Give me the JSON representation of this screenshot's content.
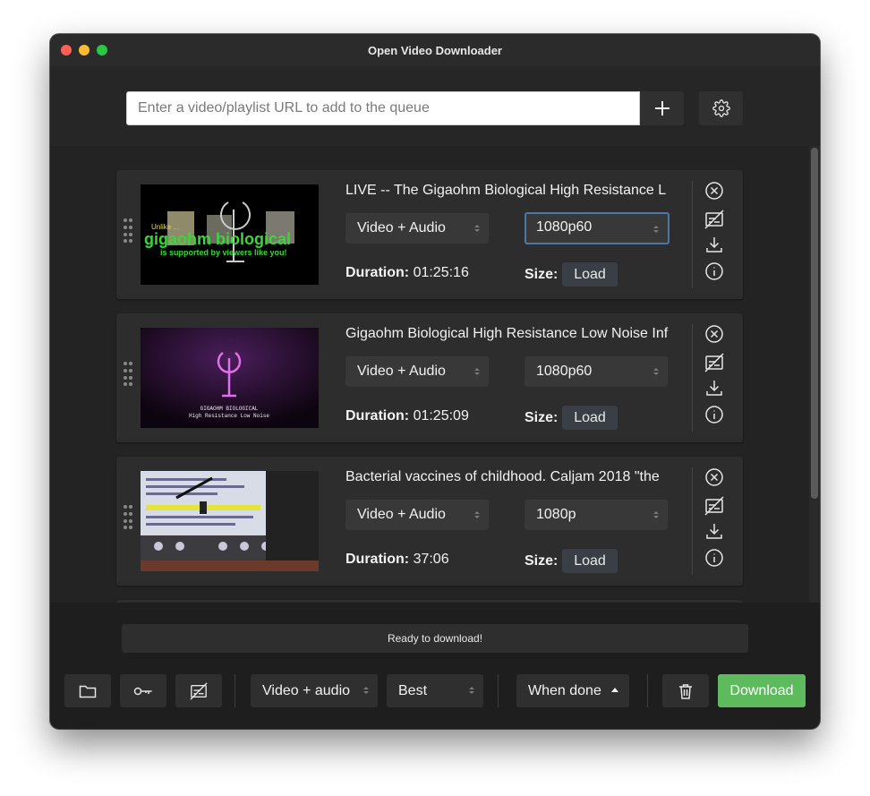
{
  "window": {
    "title": "Open Video Downloader"
  },
  "url_bar": {
    "placeholder": "Enter a video/playlist URL to add to the queue"
  },
  "queue": [
    {
      "title": "LIVE -- The Gigaohm Biological High Resistance L",
      "type": "Video + Audio",
      "quality": "1080p60",
      "duration_label": "Duration:",
      "duration": "01:25:16",
      "size_label": "Size:",
      "load_label": "Load",
      "thumbnail": {
        "line1": "Unlike ...",
        "line2": "gigaohm biological",
        "line3": "is supported by viewers like you!"
      }
    },
    {
      "title": "Gigaohm Biological High Resistance Low Noise Inf",
      "type": "Video + Audio",
      "quality": "1080p60",
      "duration_label": "Duration:",
      "duration": "01:25:09",
      "size_label": "Size:",
      "load_label": "Load",
      "thumbnail": {
        "line1": "GIGAOHM BIOLOGICAL",
        "line2": "High Resistance Low Noise"
      }
    },
    {
      "title": "Bacterial vaccines of childhood. Caljam 2018 \"the",
      "type": "Video + Audio",
      "quality": "1080p",
      "duration_label": "Duration:",
      "duration": "37:06",
      "size_label": "Size:",
      "load_label": "Load"
    }
  ],
  "status": {
    "text": "Ready to download!"
  },
  "bottom": {
    "download_type": "Video + audio",
    "quality": "Best",
    "when_done": "When done",
    "download_label": "Download"
  },
  "colors": {
    "accent_green": "#5dbb5d",
    "focus_blue": "#4f76a8",
    "window_bg": "#1e1e1e"
  },
  "icons": [
    "plus-icon",
    "gear-icon",
    "drag-handle-icon",
    "close-circle-icon",
    "no-subtitles-icon",
    "download-icon",
    "info-icon",
    "folder-icon",
    "key-icon",
    "trash-icon",
    "caret-up-icon"
  ]
}
